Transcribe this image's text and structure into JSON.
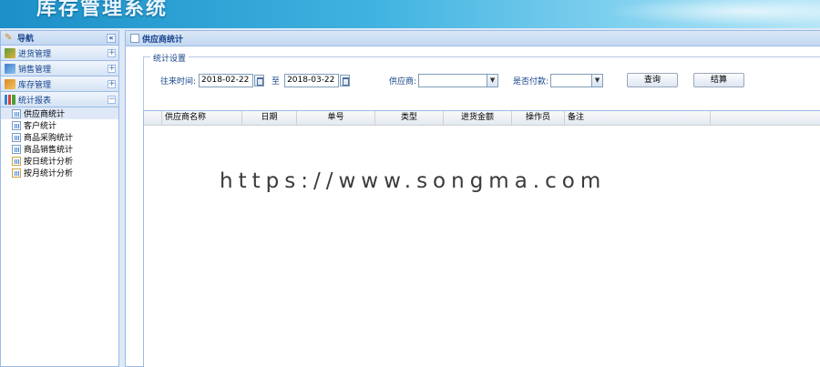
{
  "header": {
    "title": "库存管理系统"
  },
  "nav": {
    "title": "导航",
    "collapse": "«",
    "groups": [
      {
        "label": "进货管理",
        "toggle": "+"
      },
      {
        "label": "销售管理",
        "toggle": "+"
      },
      {
        "label": "库存管理",
        "toggle": "+"
      },
      {
        "label": "统计报表",
        "toggle": "−"
      }
    ],
    "items": [
      {
        "label": "供应商统计"
      },
      {
        "label": "客户统计"
      },
      {
        "label": "商品采购统计"
      },
      {
        "label": "商品销售统计"
      },
      {
        "label": "按日统计分析"
      },
      {
        "label": "按月统计分析"
      }
    ]
  },
  "main": {
    "tab_title": "供应商统计",
    "fieldset_legend": "统计设置",
    "filters": {
      "date_label": "往来时间:",
      "date_from": "2018-02-22",
      "to_label": "至",
      "date_to": "2018-03-22",
      "supplier_label": "供应商:",
      "supplier_value": "",
      "paid_label": "是否付款:",
      "paid_value": "",
      "arrow": "▼"
    },
    "buttons": {
      "query": "查询",
      "settle": "结算"
    },
    "grid": {
      "columns": [
        "供应商名称",
        "日期",
        "单号",
        "类型",
        "进货金额",
        "操作员",
        "备注"
      ]
    }
  },
  "watermark": "https://www.songma.com"
}
